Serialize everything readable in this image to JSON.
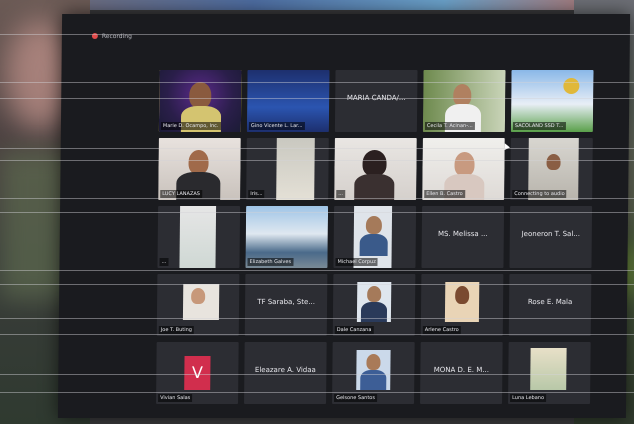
{
  "window": {
    "title": "Recording"
  },
  "participants": [
    {
      "id": "p1",
      "name": "Marie D. Ocampo, Inc.",
      "active": true,
      "kind": "video"
    },
    {
      "id": "p2",
      "name": "Gino Vicente L. Lar...",
      "kind": "video"
    },
    {
      "id": "p3",
      "name": "",
      "center": "MARIA CANDA/...",
      "kind": "name"
    },
    {
      "id": "p4",
      "name": "Cecila T. Acinan-...",
      "kind": "video"
    },
    {
      "id": "p5",
      "name": "SACOLAND SSD T...",
      "kind": "video"
    },
    {
      "id": "p6",
      "name": "LUCY LANAZAS",
      "kind": "video"
    },
    {
      "id": "p7",
      "name": "Iris...",
      "kind": "video"
    },
    {
      "id": "p8",
      "name": "...",
      "kind": "video"
    },
    {
      "id": "p9",
      "name": "Ellen B. Castro",
      "kind": "video"
    },
    {
      "id": "p10",
      "name": "Connecting to audio",
      "kind": "video"
    },
    {
      "id": "p11",
      "name": "... ",
      "kind": "video"
    },
    {
      "id": "p12",
      "name": "Elizabeth Galves",
      "kind": "video"
    },
    {
      "id": "p13",
      "name": "Michael Corpuz",
      "kind": "video"
    },
    {
      "id": "p14",
      "name": "",
      "center": "MS. Melissa ...",
      "kind": "name"
    },
    {
      "id": "p15",
      "name": "",
      "center": "Jeoneron T. Sal...",
      "kind": "name"
    },
    {
      "id": "p16",
      "name": "Joe T. Buting",
      "kind": "video"
    },
    {
      "id": "p17",
      "name": "",
      "center": "TF Saraba, Ste...",
      "kind": "name"
    },
    {
      "id": "p18",
      "name": "Dale Canzana",
      "kind": "video"
    },
    {
      "id": "p19",
      "name": "Arlene Castro",
      "kind": "video"
    },
    {
      "id": "p20",
      "name": "",
      "center": "Rose E. Mala",
      "kind": "name"
    },
    {
      "id": "p21",
      "name": "Vivian Salas",
      "kind": "letter",
      "letter": "V"
    },
    {
      "id": "p22",
      "name": "",
      "center": "Eleazare A. Vidaa",
      "kind": "name"
    },
    {
      "id": "p23",
      "name": "Gelsone Santos",
      "kind": "video"
    },
    {
      "id": "p24",
      "name": "",
      "center": "MONA D. E. M...",
      "kind": "name"
    },
    {
      "id": "p25",
      "name": "Luna Lebano",
      "kind": "video"
    }
  ]
}
